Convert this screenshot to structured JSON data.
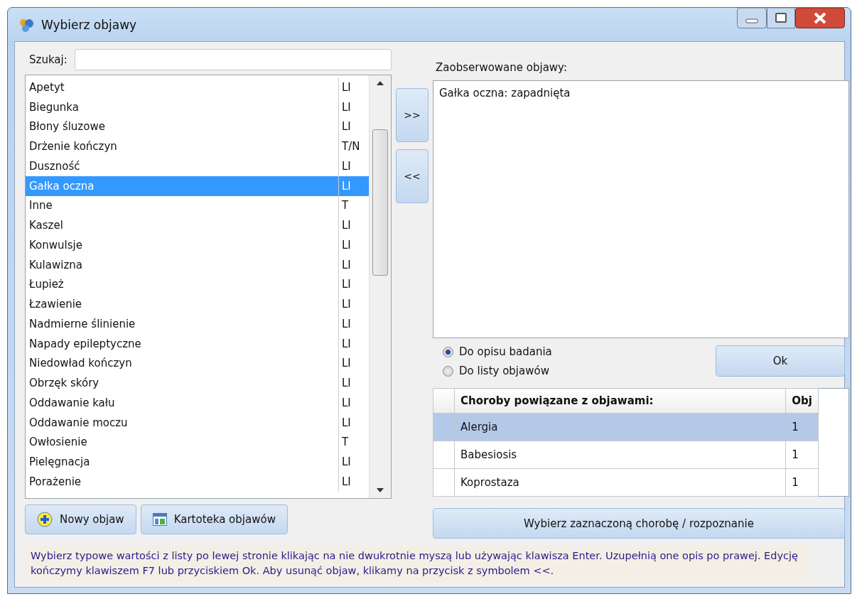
{
  "window": {
    "title": "Wybierz objawy"
  },
  "search": {
    "label": "Szukaj:"
  },
  "symptoms": [
    {
      "name": "Apetyt",
      "type": "LI",
      "selected": false
    },
    {
      "name": "Biegunka",
      "type": "LI",
      "selected": false
    },
    {
      "name": "Błony śluzowe",
      "type": "LI",
      "selected": false
    },
    {
      "name": "Drżenie kończyn",
      "type": "T/N",
      "selected": false
    },
    {
      "name": "Duszność",
      "type": "LI",
      "selected": false
    },
    {
      "name": "Gałka oczna",
      "type": "LI",
      "selected": true
    },
    {
      "name": "Inne",
      "type": "T",
      "selected": false
    },
    {
      "name": "Kaszel",
      "type": "LI",
      "selected": false
    },
    {
      "name": "Konwulsje",
      "type": "LI",
      "selected": false
    },
    {
      "name": "Kulawizna",
      "type": "LI",
      "selected": false
    },
    {
      "name": "Łupież",
      "type": "LI",
      "selected": false
    },
    {
      "name": "Łzawienie",
      "type": "LI",
      "selected": false
    },
    {
      "name": "Nadmierne ślinienie",
      "type": "LI",
      "selected": false
    },
    {
      "name": "Napady epileptyczne",
      "type": "LI",
      "selected": false
    },
    {
      "name": "Niedowład kończyn",
      "type": "LI",
      "selected": false
    },
    {
      "name": "Obrzęk skóry",
      "type": "LI",
      "selected": false
    },
    {
      "name": "Oddawanie kału",
      "type": "LI",
      "selected": false
    },
    {
      "name": "Oddawanie moczu",
      "type": "LI",
      "selected": false
    },
    {
      "name": "Owłosienie",
      "type": "T",
      "selected": false
    },
    {
      "name": "Pielęgnacja",
      "type": "LI",
      "selected": false
    },
    {
      "name": "Porażenie",
      "type": "LI",
      "selected": false
    }
  ],
  "move_buttons": [
    ">>",
    "<<"
  ],
  "observed": {
    "label": "Zaobserwowane objawy:",
    "items": [
      "Gałka oczna: zapadnięta"
    ]
  },
  "radios": [
    {
      "label": "Do opisu badania",
      "selected": true
    },
    {
      "label": "Do listy objawów",
      "selected": false
    }
  ],
  "ok_button": "Ok",
  "diseases": {
    "columns": [
      "Choroby powiązane z objawami:",
      "Obj"
    ],
    "rows": [
      {
        "name": "Alergia",
        "count": "1",
        "selected": true
      },
      {
        "name": "Babesiosis",
        "count": "1",
        "selected": false
      },
      {
        "name": "Koprostaza",
        "count": "1",
        "selected": false
      }
    ]
  },
  "left_buttons": [
    {
      "label": "Nowy objaw",
      "kind": "add"
    },
    {
      "label": "Kartoteka objawów",
      "kind": "catalog"
    }
  ],
  "select_button": "Wybierz zaznaczoną chorobę / rozpoznanie",
  "help_text": "Wybierz typowe wartości z listy po lewej stronie klikając na nie dwukrotnie myszą lub używając klawisza Enter. Uzupełnią one opis po prawej. Edycję kończymy klawiszem F7 lub przyciskiem Ok. Aby usunąć objaw, klikamy na przycisk z symbolem <<."
}
